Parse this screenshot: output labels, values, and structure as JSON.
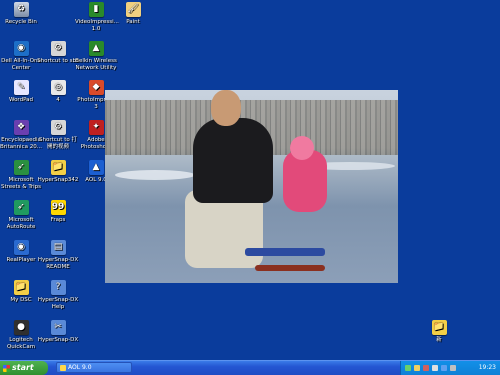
{
  "desktop": {
    "icons": [
      {
        "label": "Recycle Bin",
        "glyph": "♻"
      },
      {
        "label": "VideoImpressi... 1.0",
        "glyph": "▮"
      },
      {
        "label": "Paint",
        "glyph": "🖌"
      },
      {
        "label": "Dell All-In-One Center",
        "glyph": "◉"
      },
      {
        "label": "Shortcut to sbz",
        "glyph": "⚙"
      },
      {
        "label": "Belkin Wireless Network Utility",
        "glyph": "▲"
      },
      {
        "label": "WordPad",
        "glyph": "✎"
      },
      {
        "label": "4",
        "glyph": "◎"
      },
      {
        "label": "PhotoImpress 3",
        "glyph": "◆"
      },
      {
        "label": "Encyclopaedia Britannica 20...",
        "glyph": "❖"
      },
      {
        "label": "Shortcut to 打 開的视频",
        "glyph": "⚙"
      },
      {
        "label": "Adobe Photosho...",
        "glyph": "✦"
      },
      {
        "label": "Microsoft Streets & Trips",
        "glyph": "➶"
      },
      {
        "label": "HyperSnap342",
        "glyph": "📁"
      },
      {
        "label": "AOL 9.0",
        "glyph": "▲"
      },
      {
        "label": "Microsoft AutoRoute",
        "glyph": "➶"
      },
      {
        "label": "Fraps",
        "glyph": "99"
      },
      {
        "label": "RealPlayer",
        "glyph": "◉"
      },
      {
        "label": "HyperSnap-DX README",
        "glyph": "▤"
      },
      {
        "label": "My DSC",
        "glyph": "📁"
      },
      {
        "label": "HyperSnap-DX Help",
        "glyph": "?"
      },
      {
        "label": "Logitech QuickCam",
        "glyph": "●"
      },
      {
        "label": "HyperSnap-DX",
        "glyph": "✂"
      },
      {
        "label": "新",
        "glyph": "📁"
      }
    ]
  },
  "taskbar": {
    "start_label": "start",
    "task_label": "AOL 9.0",
    "clock": "19:23"
  },
  "colors": {
    "desktop_bg": "#0a3c9c",
    "taskbar": "#2456d2",
    "start": "#2f8f2f"
  }
}
